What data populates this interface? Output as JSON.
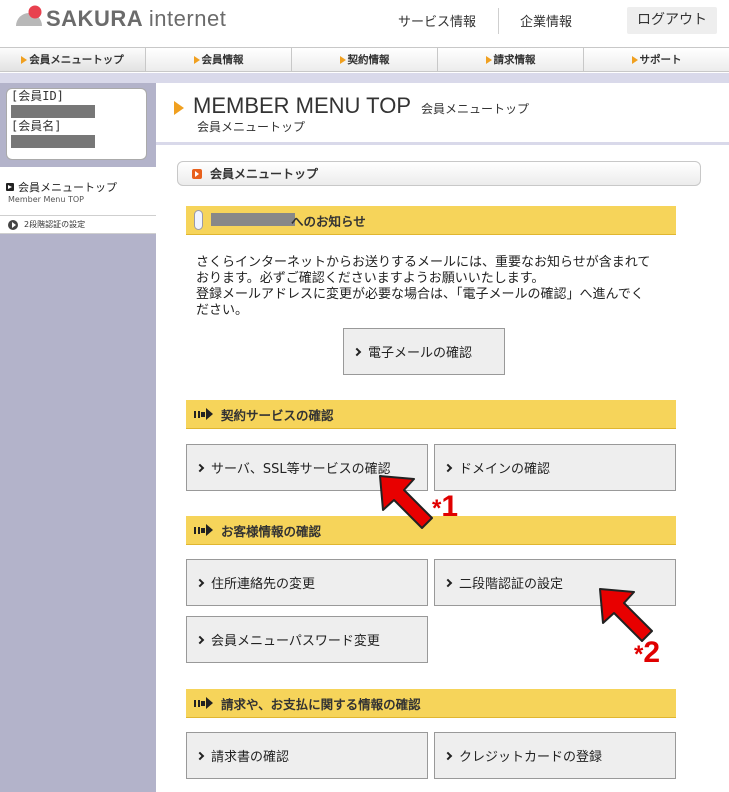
{
  "header": {
    "brand_bold": "SAKURA",
    "brand_light": "internet",
    "service_info": "サービス情報",
    "company_info": "企業情報",
    "logout": "ログアウト"
  },
  "global_nav": [
    {
      "label": "会員メニュートップ",
      "active": true
    },
    {
      "label": "会員情報",
      "active": false
    },
    {
      "label": "契約情報",
      "active": false
    },
    {
      "label": "請求情報",
      "active": false
    },
    {
      "label": "サポート",
      "active": false
    }
  ],
  "sidebar": {
    "member_id_label": "[会員ID]",
    "member_name_label": "[会員名]",
    "menu_top_label": "会員メニュートップ",
    "menu_top_sub": "Member Menu TOP",
    "two_factor_label": "2段階認証の設定"
  },
  "main": {
    "title": "MEMBER MENU TOP",
    "title_jp": "会員メニュートップ",
    "subtitle": "会員メニュートップ",
    "section_header": "会員メニュートップ"
  },
  "notice": {
    "header_suffix": "へのお知らせ",
    "line1": "さくらインターネットからお送りするメールには、重要なお知らせが含まれて",
    "line2": "おります。必ずご確認くださいますようお願いいたします。",
    "line3": "登録メールアドレスに変更が必要な場合は、「電子メールの確認」へ進んでく",
    "line4": "ださい。",
    "email_button": "電子メールの確認"
  },
  "contract_section": {
    "title": "契約サービスの確認",
    "server_button": "サーバ、SSL等サービスの確認",
    "domain_button": "ドメインの確認"
  },
  "customer_section": {
    "title": "お客様情報の確認",
    "address_button": "住所連絡先の変更",
    "two_factor_button": "二段階認証の設定",
    "password_button": "会員メニューパスワード変更"
  },
  "billing_section": {
    "title": "請求や、お支払に関する情報の確認",
    "invoice_button": "請求書の確認",
    "credit_button": "クレジットカードの登録"
  },
  "annotations": {
    "mark1_star": "*",
    "mark1_num": "1",
    "mark2_star": "*",
    "mark2_num": "2",
    "color": "#e00000"
  }
}
